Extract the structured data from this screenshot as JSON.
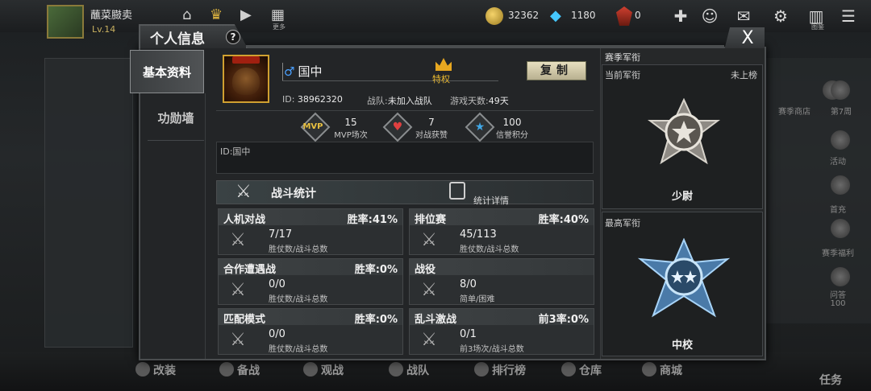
{
  "hud": {
    "player_name": "蘸菜臌卖",
    "level": "Lv.14",
    "gold": "32362",
    "diamond": "1180",
    "medal": "0",
    "icons": [
      "home-icon",
      "crown-icon",
      "video-icon",
      "grid-icon",
      "plus-icon",
      "friends-icon",
      "mail-icon",
      "settings-icon",
      "book-icon",
      "menu-icon"
    ],
    "small_labels": {
      "book": "图鉴",
      "grid": "更多"
    }
  },
  "bottom_nav": [
    "改装",
    "备战",
    "观战",
    "战队",
    "排行榜",
    "仓库",
    "商城",
    "任务"
  ],
  "right_bg": [
    "赛季商店",
    "第7周",
    "活动",
    "首充",
    "赛季福利",
    "问答",
    "100"
  ],
  "dialog": {
    "title": "个人信息",
    "help": "?",
    "close": "X",
    "tabs": [
      "基本资料",
      "功勋墙"
    ]
  },
  "profile": {
    "gender_symbol": "♂",
    "name": "国中",
    "vip_label": "特权",
    "copy_label": "复制",
    "id_label": "ID:",
    "id_value": "38962320",
    "team_label": "战队:",
    "team_value": "未加入战队",
    "days_label": "游戏天数:",
    "days_value": "49天",
    "signature": "ID:国中"
  },
  "stats": [
    {
      "icon": "mvp-icon",
      "icon_text": "MVP",
      "value": "15",
      "label": "MVP场次"
    },
    {
      "icon": "heart-icon",
      "icon_text": "♥",
      "value": "7",
      "label": "对战获赞"
    },
    {
      "icon": "star-icon",
      "icon_text": "★",
      "value": "100",
      "label": "信誉积分"
    }
  ],
  "battle": {
    "title": "战斗统计",
    "detail_label": "统计详情"
  },
  "modes": [
    {
      "title": "人机对战",
      "rate": "胜率:41%",
      "value": "7/17",
      "sub": "胜仗数/战斗总数"
    },
    {
      "title": "排位赛",
      "rate": "胜率:40%",
      "value": "45/113",
      "sub": "胜仗数/战斗总数"
    },
    {
      "title": "合作遭遇战",
      "rate": "胜率:0%",
      "value": "0/0",
      "sub": "胜仗数/战斗总数"
    },
    {
      "title": "战役",
      "rate": "",
      "value": "8/0",
      "sub": "简单/困难"
    },
    {
      "title": "匹配模式",
      "rate": "胜率:0%",
      "value": "0/0",
      "sub": "胜仗数/战斗总数"
    },
    {
      "title": "乱斗激战",
      "rate": "前3率:0%",
      "value": "0/1",
      "sub": "前3场次/战斗总数"
    }
  ],
  "rank": {
    "season_title": "赛季军衔",
    "current_label": "当前军衔",
    "current_status": "未上榜",
    "current_rank": "少尉",
    "highest_label": "最高军衔",
    "highest_rank": "中校"
  }
}
